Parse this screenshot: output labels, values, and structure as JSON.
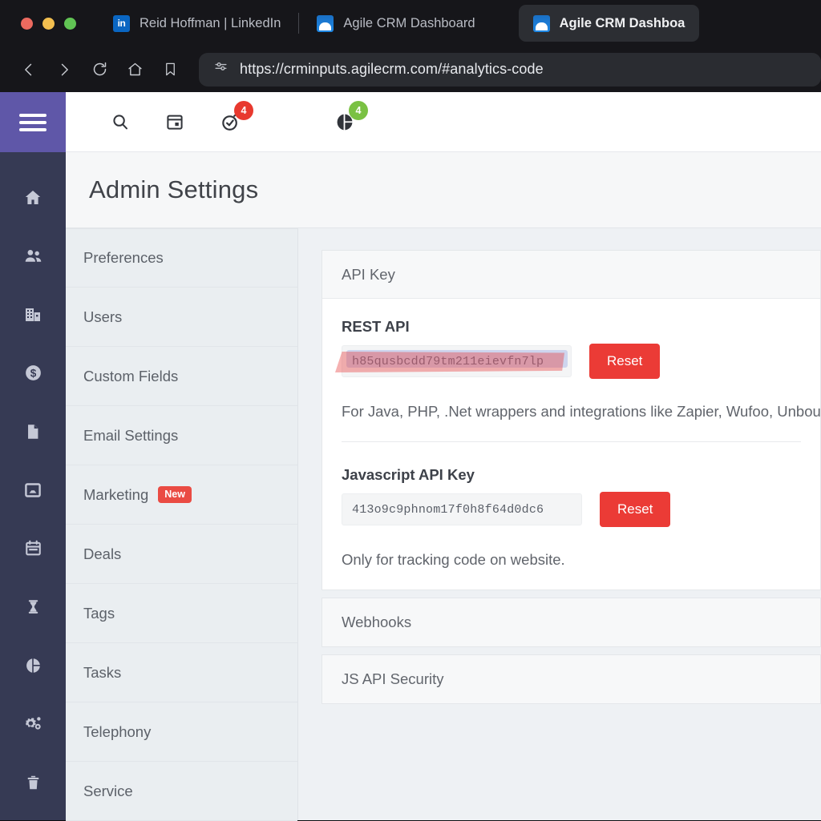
{
  "browser": {
    "tabs": [
      {
        "title": "Reid Hoffman | LinkedIn",
        "favicon": "linkedin-icon",
        "active": false
      },
      {
        "title": "Agile CRM Dashboard",
        "favicon": "agile-cloud-icon",
        "active": false
      },
      {
        "title": "Agile CRM Dashboa",
        "favicon": "agile-cloud-icon",
        "active": true
      }
    ],
    "nav": {
      "back": "back-arrow-icon",
      "forward": "forward-arrow-icon",
      "reload": "reload-icon",
      "home": "home-icon",
      "bookmark": "bookmark-icon"
    },
    "url": "https://crminputs.agilecrm.com/#analytics-code",
    "url_prefix_icon": "site-settings-icon"
  },
  "rail": {
    "menu_icon": "hamburger-menu-icon",
    "items": [
      {
        "icon": "home-icon",
        "name": "home"
      },
      {
        "icon": "contacts-people-icon",
        "name": "contacts"
      },
      {
        "icon": "company-building-icon",
        "name": "companies"
      },
      {
        "icon": "deals-dollar-icon",
        "name": "deals"
      },
      {
        "icon": "document-icon",
        "name": "documents"
      },
      {
        "icon": "inbox-icon",
        "name": "inbox"
      },
      {
        "icon": "calendar-icon",
        "name": "calendar"
      },
      {
        "icon": "hourglass-icon",
        "name": "campaigns"
      },
      {
        "icon": "pie-chart-icon",
        "name": "reports"
      },
      {
        "icon": "gears-settings-icon",
        "name": "settings"
      },
      {
        "icon": "trash-icon",
        "name": "trash"
      }
    ]
  },
  "appbar": {
    "icons": [
      {
        "icon": "search-icon",
        "badge": null,
        "badge_color": null
      },
      {
        "icon": "calendar-icon",
        "badge": null,
        "badge_color": null
      },
      {
        "icon": "timer-check-icon",
        "badge": "4",
        "badge_color": "#e8392e"
      },
      {
        "icon": "pie-chart-icon",
        "badge": "4",
        "badge_color": "#7ac143"
      }
    ]
  },
  "page": {
    "title": "Admin Settings"
  },
  "settings_nav": {
    "items": [
      {
        "label": "Preferences",
        "badge": null
      },
      {
        "label": "Users",
        "badge": null
      },
      {
        "label": "Custom Fields",
        "badge": null
      },
      {
        "label": "Email Settings",
        "badge": null
      },
      {
        "label": "Marketing",
        "badge": "New"
      },
      {
        "label": "Deals",
        "badge": null
      },
      {
        "label": "Tags",
        "badge": null
      },
      {
        "label": "Tasks",
        "badge": null
      },
      {
        "label": "Telephony",
        "badge": null
      },
      {
        "label": "Service",
        "badge": null
      }
    ]
  },
  "panels": {
    "api_key": {
      "heading": "API Key",
      "rest": {
        "label": "REST API",
        "value": "h85qusbcdd79tm211eievfn7lp",
        "reset_label": "Reset",
        "hint": "For Java, PHP, .Net wrappers and integrations like Zapier, Wufoo, Unbou"
      },
      "javascript": {
        "label": "Javascript API Key",
        "value": "413o9c9phnom17f0h8f64d0dc6",
        "reset_label": "Reset",
        "hint": "Only for tracking code on website."
      }
    },
    "webhooks": {
      "heading": "Webhooks"
    },
    "js_api_security": {
      "heading": "JS API Security"
    }
  },
  "colors": {
    "rail": "#363a54",
    "rail_accent": "#5f57a8",
    "reset_red": "#eb3b36",
    "badge_red": "#e8392e",
    "badge_green": "#7ac143",
    "new_badge": "#ea4b43",
    "highlight_pink": "#e84646"
  }
}
